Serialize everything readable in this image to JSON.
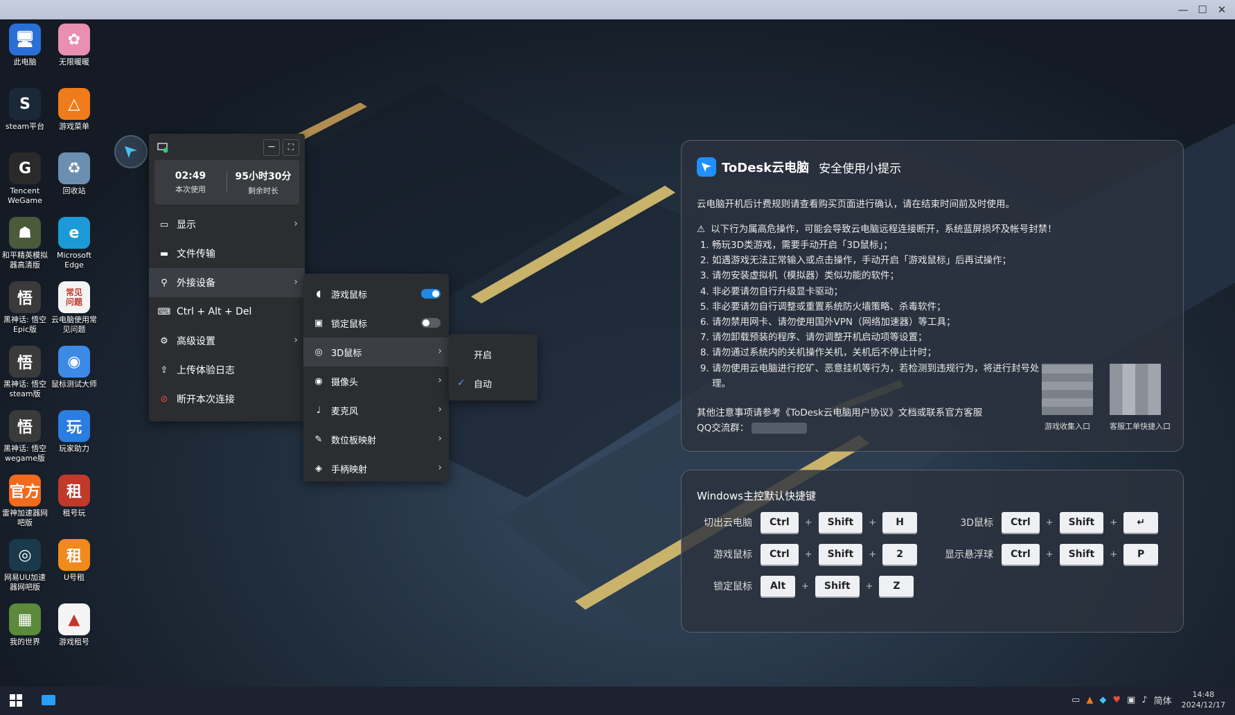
{
  "window": {
    "controls": [
      "—",
      "☐",
      "✕"
    ]
  },
  "desktop_icons": [
    {
      "label": "此电脑",
      "glyph": "🖥",
      "bg": "#2a6fd6"
    },
    {
      "label": "无限暖暖",
      "glyph": "✿",
      "bg": "#e88fb2"
    },
    {
      "label": "steam平台",
      "glyph": "S",
      "bg": "#1b2838"
    },
    {
      "label": "游戏菜单",
      "glyph": "△",
      "bg": "#f07b1c"
    },
    {
      "label": "Tencent WeGame",
      "glyph": "G",
      "bg": "#2a2a2a"
    },
    {
      "label": "回收站",
      "glyph": "♻",
      "bg": "#6a8fb0"
    },
    {
      "label": "和平精英模拟器高清版",
      "glyph": "☗",
      "bg": "#4a5a3a"
    },
    {
      "label": "Microsoft Edge",
      "glyph": "e",
      "bg": "#1c9ad6"
    },
    {
      "label": "黑神话: 悟空Epic版",
      "glyph": "悟",
      "bg": "#3a3a3a"
    },
    {
      "label": "云电脑使用常见问题",
      "glyph": "常见\n问题",
      "bg": "#f4f4f4"
    },
    {
      "label": "黑神话: 悟空steam版",
      "glyph": "悟",
      "bg": "#3a3a3a"
    },
    {
      "label": "鼠标测试大师",
      "glyph": "◉",
      "bg": "#3c8ae6"
    },
    {
      "label": "黑神话: 悟空wegame版",
      "glyph": "悟",
      "bg": "#3a3a3a"
    },
    {
      "label": "玩家助力",
      "glyph": "玩",
      "bg": "#2a7de1"
    },
    {
      "label": "雷神加速器网吧版",
      "glyph": "官方",
      "bg": "#f26a1b"
    },
    {
      "label": "租号玩",
      "glyph": "租",
      "bg": "#c0392b"
    },
    {
      "label": "网易UU加速器网吧版",
      "glyph": "◎",
      "bg": "#1a3a4a"
    },
    {
      "label": "U号租",
      "glyph": "租",
      "bg": "#f08a1c"
    },
    {
      "label": "我的世界",
      "glyph": "▦",
      "bg": "#5a8a3a"
    },
    {
      "label": "游戏租号",
      "glyph": "▲",
      "bg": "#f4f4f4"
    }
  ],
  "floating_menu": {
    "usage_time": "02:49",
    "usage_label": "本次使用",
    "remaining_time": "95小时30分",
    "remaining_label": "剩余时长",
    "items": [
      {
        "label": "显示",
        "icon": "monitor-icon",
        "glyph": "▭",
        "arrow": true
      },
      {
        "label": "文件传输",
        "icon": "folder-icon",
        "glyph": "▬",
        "arrow": false
      },
      {
        "label": "外接设备",
        "icon": "usb-icon",
        "glyph": "⚲",
        "arrow": true
      },
      {
        "label": "Ctrl + Alt + Del",
        "icon": "keyboard-icon",
        "glyph": "⌨",
        "arrow": false
      },
      {
        "label": "高级设置",
        "icon": "sliders-icon",
        "glyph": "⚙",
        "arrow": true
      },
      {
        "label": "上传体验日志",
        "icon": "upload-log-icon",
        "glyph": "⇪",
        "arrow": false
      },
      {
        "label": "断开本次连接",
        "icon": "disconnect-icon",
        "glyph": "⊘",
        "arrow": false
      }
    ]
  },
  "device_submenu": {
    "items": [
      {
        "label": "游戏鼠标",
        "icon": "mouse-icon",
        "glyph": "◖",
        "toggle": "on"
      },
      {
        "label": "锁定鼠标",
        "icon": "lock-mouse-icon",
        "glyph": "▣",
        "toggle": "off"
      },
      {
        "label": "3D鼠标",
        "icon": "3d-mouse-icon",
        "glyph": "◎",
        "arrow": true
      },
      {
        "label": "摄像头",
        "icon": "camera-icon",
        "glyph": "◉",
        "arrow": true
      },
      {
        "label": "麦克风",
        "icon": "microphone-icon",
        "glyph": "♩",
        "arrow": true
      },
      {
        "label": "数位板映射",
        "icon": "tablet-icon",
        "glyph": "✎",
        "arrow": true
      },
      {
        "label": "手柄映射",
        "icon": "gamepad-icon",
        "glyph": "◈",
        "arrow": true
      }
    ]
  },
  "mouse3d_submenu": {
    "options": [
      {
        "label": "开启",
        "checked": false
      },
      {
        "label": "自动",
        "checked": true
      }
    ]
  },
  "tips": {
    "brand": "ToDesk云电脑",
    "title": "安全使用小提示",
    "intro": "云电脑开机后计费规则请查看购买页面进行确认，请在结束时间前及时使用。",
    "warning": "以下行为属高危操作，可能会导致云电脑远程连接断开，系统蓝屏损坏及帐号封禁！",
    "rules": [
      "畅玩3D类游戏，需要手动开启「3D鼠标」；",
      "如遇游戏无法正常输入或点击操作，手动开启「游戏鼠标」后再试操作；",
      "请勿安装虚拟机（模拟器）类似功能的软件；",
      "非必要请勿自行升级显卡驱动；",
      "非必要请勿自行调整或重置系统防火墙策略、杀毒软件；",
      "请勿禁用网卡、请勿使用国外VPN（网络加速器）等工具；",
      "请勿卸载预装的程序、请勿调整开机启动项等设置；",
      "请勿通过系统内的关机操作关机，关机后不停止计时；",
      "请勿使用云电脑进行挖矿、恶意挂机等行为，若检测到违规行为，将进行封号处理。"
    ],
    "other": "其他注意事项请参考《ToDesk云电脑用户协议》文档或联系官方客服",
    "qq_label": "QQ交流群：",
    "qr1_caption": "游戏收集入口",
    "qr2_caption": "客服工单快捷入口"
  },
  "shortcuts": {
    "title": "Windows主控默认快捷键",
    "rows": [
      {
        "label": "切出云电脑",
        "keys": [
          "Ctrl",
          "Shift",
          "H"
        ]
      },
      {
        "label": "游戏鼠标",
        "keys": [
          "Ctrl",
          "Shift",
          "2"
        ]
      },
      {
        "label": "锁定鼠标",
        "keys": [
          "Alt",
          "Shift",
          "Z"
        ]
      },
      {
        "label": "3D鼠标",
        "keys": [
          "Ctrl",
          "Shift",
          "↵"
        ]
      },
      {
        "label": "显示悬浮球",
        "keys": [
          "Ctrl",
          "Shift",
          "P"
        ]
      }
    ]
  },
  "taskbar": {
    "ime": "简体",
    "time": "14:48",
    "date": "2024/12/17"
  },
  "colors": {
    "accent": "#1e88e5",
    "menu_bg": "#2b2d31"
  }
}
